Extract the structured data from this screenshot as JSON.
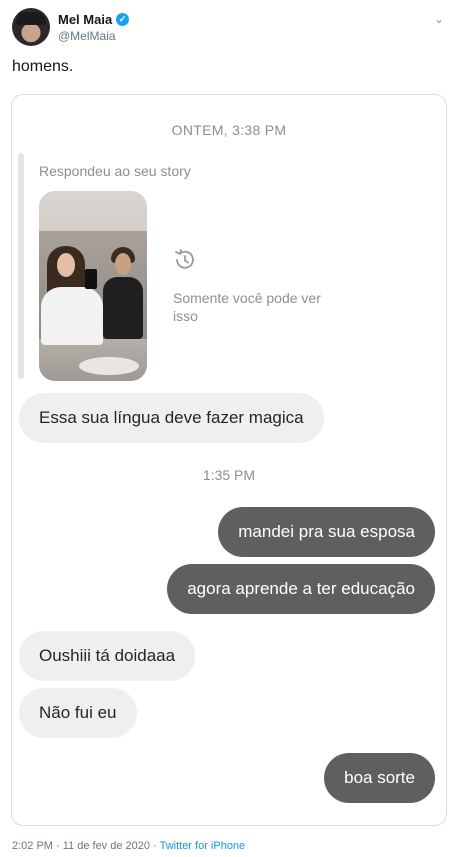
{
  "tweet": {
    "display_name": "Mel Maia",
    "handle": "@MelMaia",
    "text": "homens.",
    "verified_icon": "✓",
    "menu_icon": "⌄",
    "footer": {
      "time_date": "2:02 PM · 11 de fev de 2020 · ",
      "source": "Twitter for iPhone"
    }
  },
  "dm": {
    "timestamp_top": "ONTEM, 3:38 PM",
    "replied_label": "Respondeu ao seu story",
    "story_visibility": "Somente você pode ver isso",
    "timestamp_mid": "1:35 PM",
    "messages": [
      {
        "side": "received",
        "text": "Essa sua língua deve fazer magica"
      },
      {
        "side": "sent",
        "text": "mandei pra sua esposa"
      },
      {
        "side": "sent",
        "text": "agora aprende a ter educação"
      },
      {
        "side": "received",
        "text": "Oushiii tá doidaaa"
      },
      {
        "side": "received",
        "text": "Não fui eu"
      },
      {
        "side": "sent",
        "text": "boa sorte"
      }
    ]
  },
  "colors": {
    "received_bubble": "#efefef",
    "sent_bubble": "#5f5f5f",
    "meta_gray": "#8e8e93",
    "link_blue": "#1b95e0",
    "verified_blue": "#1da1f2"
  }
}
